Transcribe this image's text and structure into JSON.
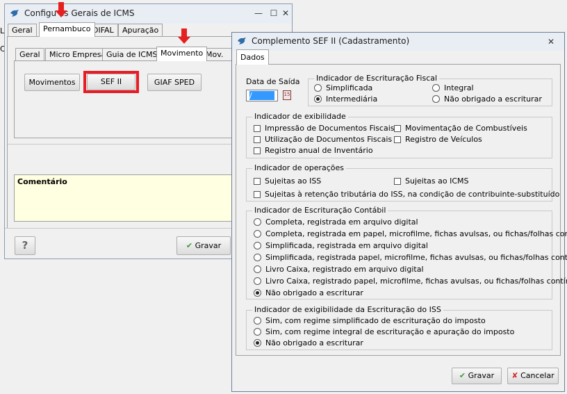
{
  "back_window": {
    "title": "Configurações Gerais de ICMS",
    "title_display": "Configu es Gerais de ICMS",
    "minimize": "—",
    "maximize": "☐",
    "close": "✕",
    "tabs": [
      "Geral",
      "Pernambuco",
      "DIFAL",
      "Apuração"
    ],
    "subtabs": [
      "Geral",
      "Micro Empresa",
      "Guia de ICMS",
      "Movimento",
      "Mov. GI"
    ],
    "buttons": {
      "movimentos": "Movimentos",
      "sef": "SEF II",
      "giaf": "GIAF SPED"
    },
    "comment_label": "Comentário",
    "help": "?",
    "save": "Gravar"
  },
  "dialog": {
    "title": "Complemento SEF II (Cadastramento)",
    "close": "✕",
    "tab": "Dados",
    "date_label": "Data de Saída",
    "date_value": " /",
    "calendar_label": "15",
    "escrituracao": {
      "title": "Indicador de Escrituração Fiscal",
      "options": [
        "Simplificada",
        "Intermediária",
        "Integral",
        "Não obrigado a escriturar"
      ]
    },
    "exibilidade": {
      "title": "Indicador de exibilidade",
      "options": [
        "Impressão de Documentos Fiscais",
        "Utilização de Documentos Fiscais",
        "Registro anual de Inventário",
        "Movimentação de Combustíveis",
        "Registro de Veículos"
      ]
    },
    "operacoes": {
      "title": "Indicador de operações",
      "options": [
        "Sujeitas ao ISS",
        "Sujeitas ao ICMS",
        "Sujeitas à retenção tributária do ISS, na condição de contribuinte-substituído"
      ]
    },
    "contabil": {
      "title": "Indicador de Escrituração Contábil",
      "options": [
        "Completa, registrada em arquivo digital",
        "Completa, registrada em papel, microfilme, fichas avulsas, ou fichas/folhas contínuas",
        "Simplificada, registrada em arquivo digital",
        "Simplificada, registrada papel, microfilme, fichas avulsas, ou fichas/folhas contínuas",
        "Livro Caixa, registrado em arquivo digital",
        "Livro Caixa, registrado papel, microfilme, fichas avulsas, ou fichas/folhas contínuas",
        "Não obrigado a escriturar"
      ]
    },
    "iss": {
      "title": "Indicador de exigibilidade da Escrituração do ISS",
      "options": [
        "Sim, com regime simplificado de escrituração do imposto",
        "Sim, com regime integral de escrituração e apuração do imposto",
        "Não obrigado a escriturar"
      ]
    },
    "save": "Gravar",
    "cancel": "Cancelar"
  },
  "colors": {
    "highlight": "#e81c24",
    "comment_bg": "#ffffe1",
    "date_bg": "#3399ff",
    "annotation_arrow": "#e62020"
  },
  "icons": [
    "bird-app-icon",
    "calendar-icon",
    "check-icon",
    "cross-icon",
    "red-arrow-icon"
  ]
}
